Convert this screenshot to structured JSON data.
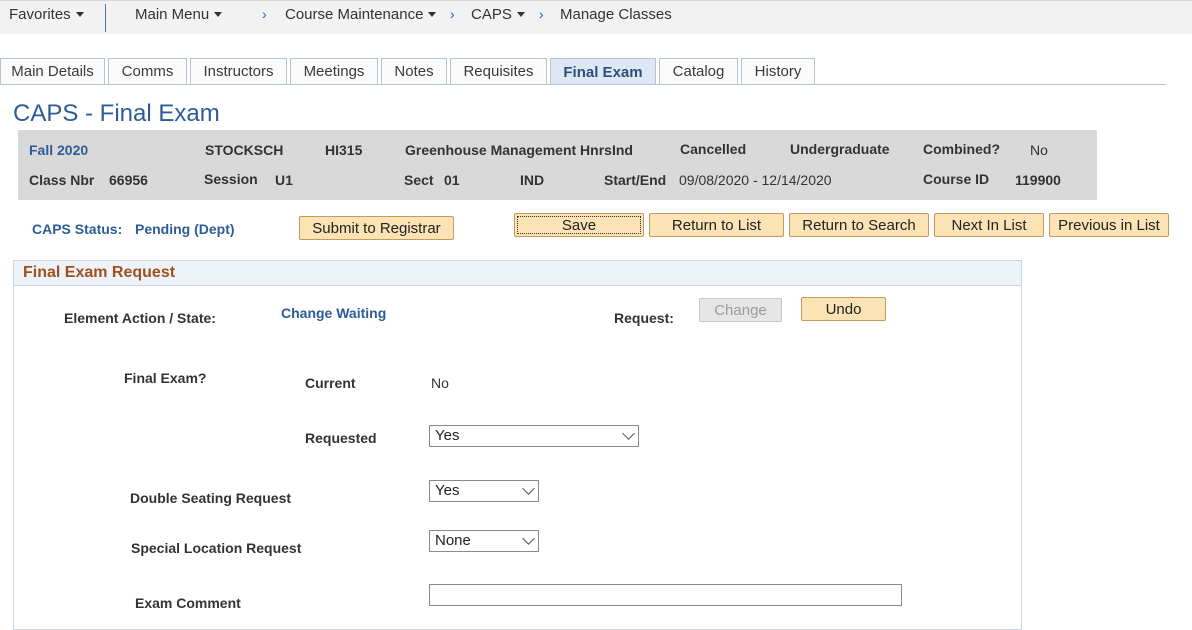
{
  "nav": {
    "favorites": "Favorites",
    "main_menu": "Main Menu",
    "breadcrumb": [
      "Course Maintenance",
      "CAPS",
      "Manage Classes"
    ]
  },
  "tabs": [
    {
      "label": "Main Details"
    },
    {
      "label": "Comms"
    },
    {
      "label": "Instructors"
    },
    {
      "label": "Meetings"
    },
    {
      "label": "Notes"
    },
    {
      "label": "Requisites"
    },
    {
      "label": "Final Exam",
      "active": true
    },
    {
      "label": "Catalog"
    },
    {
      "label": "History"
    }
  ],
  "page_title": "CAPS - Final Exam",
  "class_info": {
    "term": "Fall 2020",
    "dept": "STOCKSCH",
    "course": "HI315",
    "course_title": "Greenhouse Management HnrsInd",
    "status": "Cancelled",
    "career": "Undergraduate",
    "combined_label": "Combined?",
    "combined_value": "No",
    "class_nbr_label": "Class Nbr",
    "class_nbr": "66956",
    "session_label": "Session",
    "session": "U1",
    "sect_label": "Sect",
    "sect": "01",
    "component": "IND",
    "start_end_label": "Start/End",
    "start_end": "09/08/2020 - 12/14/2020",
    "course_id_label": "Course ID",
    "course_id": "119900"
  },
  "caps_status": {
    "label": "CAPS Status:",
    "value": "Pending (Dept)"
  },
  "buttons": {
    "submit": "Submit to Registrar",
    "save": "Save",
    "return_list": "Return to List",
    "return_search": "Return to Search",
    "next": "Next In List",
    "previous": "Previous in List",
    "change": "Change",
    "undo": "Undo"
  },
  "panel": {
    "title": "Final Exam Request",
    "element_action_label": "Element Action / State:",
    "element_action_value": "Change Waiting",
    "request_label": "Request:",
    "final_exam_label": "Final Exam?",
    "current_label": "Current",
    "current_value": "No",
    "requested_label": "Requested",
    "requested_value": "Yes",
    "double_seating_label": "Double Seating Request",
    "double_seating_value": "Yes",
    "special_location_label": "Special Location Request",
    "special_location_value": "None",
    "exam_comment_label": "Exam Comment",
    "exam_comment_value": ""
  }
}
